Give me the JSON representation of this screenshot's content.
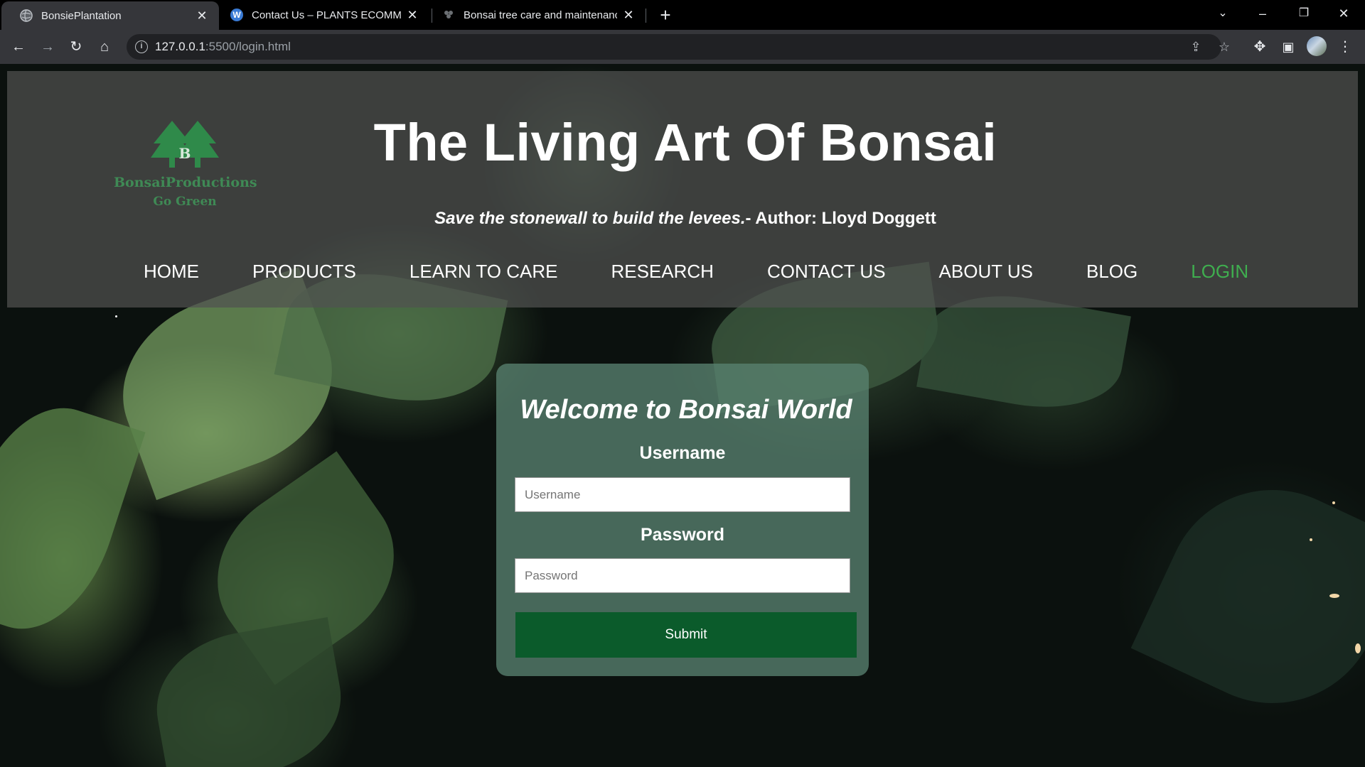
{
  "browser": {
    "tabs": [
      {
        "title": "BonsiePlantation",
        "active": true,
        "icon": "globe-icon"
      },
      {
        "title": "Contact Us – PLANTS ECOMMERCE",
        "active": false,
        "icon": "wordpress-icon"
      },
      {
        "title": "Bonsai tree care and maintenance",
        "active": false,
        "icon": "bonsai-favicon-icon"
      }
    ],
    "url_host": "127.0.0.1",
    "url_path": ":5500/login.html"
  },
  "site": {
    "logo": {
      "brand": "BonsaiProductions",
      "tagline": "Go Green",
      "letter": "B"
    },
    "heading": "The Living Art Of Bonsai",
    "quote_italic": "Save the stonewall to build the levees.",
    "quote_author": "- Author: Lloyd Doggett",
    "nav": [
      "HOME",
      "PRODUCTS",
      "LEARN TO CARE",
      "RESEARCH",
      "CONTACT US",
      "ABOUT US",
      "BLOG",
      "LOGIN"
    ],
    "nav_active": "LOGIN"
  },
  "login": {
    "title": "Welcome to Bonsai World",
    "username_label": "Username",
    "username_placeholder": "Username",
    "password_label": "Password",
    "password_placeholder": "Password",
    "submit_label": "Submit"
  },
  "colors": {
    "nav_active": "#3fae4f",
    "logo_green": "#3f8a55",
    "submit_bg": "#0b5b2b",
    "card_bg": "#58826f"
  }
}
